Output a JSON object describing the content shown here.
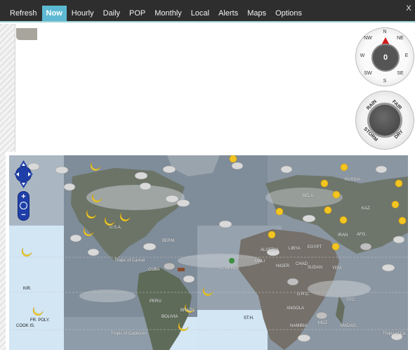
{
  "nav": {
    "tabs": [
      "Refresh",
      "Now",
      "Hourly",
      "Daily",
      "POP",
      "Monthly",
      "Local",
      "Alerts",
      "Maps",
      "Options"
    ],
    "active_tab": "Now",
    "close_label": "X"
  },
  "compass": {
    "value": "0",
    "directions": {
      "n": "N",
      "ne": "NE",
      "e": "E",
      "se": "SE",
      "s": "S",
      "sw": "SW",
      "w": "W",
      "nw": "NW"
    }
  },
  "barometer": {
    "labels": {
      "rain": "RAIN",
      "fair": "FAIR",
      "storm": "STORM",
      "dry": "DRY"
    }
  },
  "map": {
    "labels": {
      "usa": "U.S.A.",
      "berm": "BERM.",
      "tropic_of_cancer": "Tropic of Cancer",
      "cuba": "CUBA",
      "kir": "KIR.",
      "fr_poly": "FR. POLY.",
      "cook_is": "COOK IS.",
      "bolivia": "BOLIVIA",
      "brazil": "BRAZIL",
      "peru": "PERU",
      "tropic_of_capricorn_1": "Tropic of Capricorn",
      "tropic_of_capricorn_2": "Tropic of Ca",
      "st_h": "ST.H.",
      "c_verde": "C. VERDE",
      "mali": "MALI",
      "niger": "NIGER",
      "chad": "CHAD",
      "libya": "LIBYA",
      "egypt": "EGYPT",
      "sudan": "SUDAN",
      "yemen": "YEM.",
      "dr_congo": "D.R.C.",
      "angola": "ANGOLA",
      "namibia": "NAMIBIA",
      "moz": "MOZ.",
      "madag": "MADAG.",
      "syc": "SYC.",
      "belarus": "BELA.",
      "russia": "RUSSIA",
      "kaz": "KAZ.",
      "iran": "IRAN",
      "afg": "AFG.",
      "algeria": "ALGERIA"
    },
    "zoom_in": "+",
    "zoom_out": "−"
  }
}
